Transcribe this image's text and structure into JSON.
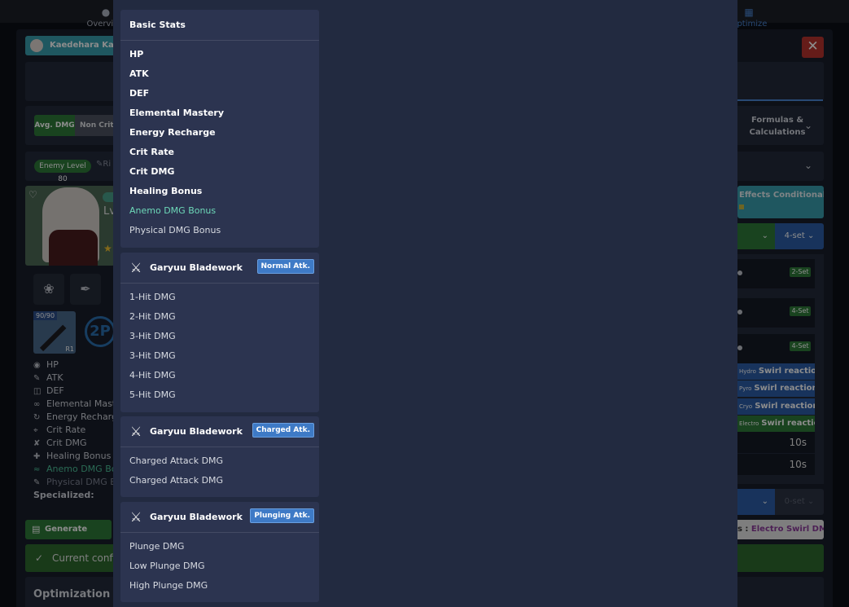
{
  "app": {
    "character_name": "Kaedehara Kazuha",
    "close_label": "✕",
    "tabs": [
      {
        "label": "Overview",
        "icon": "person-icon"
      },
      {
        "label": "Optimize",
        "icon": "grid-icon"
      }
    ],
    "dmg_modes": [
      "Avg. DMG",
      "Non Crit DMG"
    ],
    "formulas_label": "Formulas & Calculations",
    "enemy_level_label": "Enemy Level 80",
    "level_label": "Lv",
    "weapon_level": "90/90",
    "weapon_refine": "R1",
    "set_badge": "2P",
    "stats": [
      {
        "label": "HP",
        "icon": "hp-icon",
        "style": "normal"
      },
      {
        "label": "ATK",
        "icon": "atk-icon",
        "style": "normal"
      },
      {
        "label": "DEF",
        "icon": "def-icon",
        "style": "normal"
      },
      {
        "label": "Elemental Mastery",
        "icon": "em-icon",
        "style": "normal"
      },
      {
        "label": "Energy Recharge",
        "icon": "er-icon",
        "style": "normal"
      },
      {
        "label": "Crit Rate",
        "icon": "crit-rate-icon",
        "style": "normal"
      },
      {
        "label": "Crit DMG",
        "icon": "crit-dmg-icon",
        "style": "normal"
      },
      {
        "label": "Healing Bonus",
        "icon": "healing-icon",
        "style": "normal"
      },
      {
        "label": "Anemo DMG Bonus",
        "icon": "anemo-icon",
        "style": "anemo"
      },
      {
        "label": "Physical DMG Bonus",
        "icon": "physical-icon",
        "style": "phys"
      }
    ],
    "specialized_label": "Specialized:",
    "generate_builds_label": "Generate Builds",
    "current_config_label": "Current configuration",
    "optimization_target_label": "Optimization Target",
    "right": {
      "conditionals_label": "Effects Conditionals",
      "set_4": "4-set",
      "set_0": "0-set",
      "set_badges": [
        "2-Set",
        "4-Set",
        "4-Set"
      ],
      "swirl_label": "Swirl reaction",
      "swirl_prefixes": [
        "Hydro",
        "Pyro",
        "Cryo",
        "Electro"
      ],
      "durations": [
        "10s",
        "10s"
      ],
      "target_label": "Electro Swirl DMG",
      "target_prefix": "s :"
    }
  },
  "dropdown": {
    "basic_stats": {
      "title": "Basic Stats",
      "items": [
        {
          "label": "HP",
          "style": "bold"
        },
        {
          "label": "ATK",
          "style": "bold"
        },
        {
          "label": "DEF",
          "style": "bold"
        },
        {
          "label": "Elemental Mastery",
          "style": "bold"
        },
        {
          "label": "Energy Recharge",
          "style": "bold"
        },
        {
          "label": "Crit Rate",
          "style": "bold"
        },
        {
          "label": "Crit DMG",
          "style": "bold"
        },
        {
          "label": "Healing Bonus",
          "style": "bold"
        },
        {
          "label": "Anemo DMG Bonus",
          "style": "anemo"
        },
        {
          "label": "Physical DMG Bonus",
          "style": "light"
        }
      ]
    },
    "normal_attack": {
      "title": "Garyuu Bladework",
      "badge": "Normal Atk.",
      "items": [
        "1-Hit DMG",
        "2-Hit DMG",
        "3-Hit DMG",
        "3-Hit DMG",
        "4-Hit DMG",
        "5-Hit DMG"
      ]
    },
    "charged_attack": {
      "title": "Garyuu Bladework",
      "badge": "Charged Atk.",
      "items": [
        "Charged Attack DMG",
        "Charged Attack DMG"
      ]
    },
    "plunging_attack": {
      "title": "Garyuu Bladework",
      "badge": "Plunging Atk.",
      "items": [
        "Plunge DMG",
        "Low Plunge DMG",
        "High Plunge DMG"
      ]
    }
  }
}
